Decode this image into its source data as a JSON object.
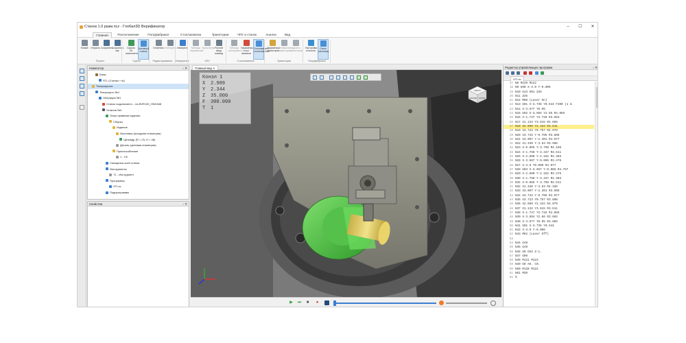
{
  "window": {
    "title": "Станок 1.0 разм.ncz - Глобал3D Верификатор",
    "min": "–",
    "max": "☐",
    "close": "✕"
  },
  "menu_tabs": [
    {
      "label": "Главная",
      "active": true
    },
    {
      "label": "Расположение",
      "active": false
    },
    {
      "label": "Полуфабрикат",
      "active": false
    },
    {
      "label": "Стол/захватки",
      "active": false
    },
    {
      "label": "Траектории",
      "active": false
    },
    {
      "label": "ЧПУ и станок",
      "active": false
    },
    {
      "label": "Анализ",
      "active": false
    },
    {
      "label": "Вид",
      "active": false
    }
  ],
  "ribbon": {
    "buttons": [
      {
        "label": "Новый",
        "color": "#7a8a99",
        "dim": false,
        "sel": false
      },
      {
        "label": "Открыть",
        "color": "#7a8a99",
        "dim": false,
        "sel": false
      },
      {
        "label": "Сохранить",
        "color": "#4c6f95",
        "dim": false,
        "sel": false
      },
      {
        "label": "Сохранить как",
        "color": "#4c6f95",
        "dim": false,
        "sel": false
      },
      {
        "label": "Скрыть СК компонентов",
        "color": "#3f9a5a",
        "dim": false,
        "sel": false
      },
      {
        "label": "Активный станок",
        "color": "#4a8fd6",
        "dim": false,
        "sel": true
      },
      {
        "label": "Отменить",
        "color": "#7b8894",
        "dim": false,
        "sel": false
      },
      {
        "label": "Повторить",
        "color": "#7b8894",
        "dim": true,
        "sel": false
      },
      {
        "label": "Измерить",
        "color": "#3b7fcc",
        "dim": false,
        "sel": false
      },
      {
        "label": "Таблица параметров",
        "color": "#a0a8b0",
        "dim": true,
        "sel": false
      },
      {
        "label": "Транслятор",
        "color": "#a0a8b0",
        "dim": true,
        "sel": false
      },
      {
        "label": "Ручной ввод команд",
        "color": "#6b7d8f",
        "dim": false,
        "sel": false
      },
      {
        "label": "Таблица инструмента",
        "color": "#a0a8b0",
        "dim": true,
        "sel": false
      },
      {
        "label": "Параметры стол/захватки",
        "color": "#d44a3a",
        "dim": false,
        "sel": false
      },
      {
        "label": "Отслеживать столкновения",
        "color": "#4a8fd6",
        "dim": false,
        "sel": true
      },
      {
        "label": "Параметры траектории",
        "color": "#d4a53a",
        "dim": false,
        "sel": false
      },
      {
        "label": "Отобразить траекторию",
        "color": "#a0a8b0",
        "dim": true,
        "sel": false
      },
      {
        "label": "Удалить траекторию",
        "color": "#a0a8b0",
        "dim": true,
        "sel": false
      },
      {
        "label": "Настройки точности",
        "color": "#3a8fd0",
        "dim": false,
        "sel": false
      },
      {
        "label": "Снять заготовку",
        "color": "#4a8fd6",
        "dim": false,
        "sel": true
      }
    ],
    "groups": [
      "Проект",
      "Сцена",
      "Редактирование",
      "Измерение",
      "ЧПУ",
      "Столкновения",
      "Траектории",
      "Полуфабрикат"
    ]
  },
  "navigator": {
    "title": "Навигатор",
    "items": [
      {
        "label": "Базы",
        "indent": 1,
        "color": "#8a6a3a",
        "hl": false
      },
      {
        "label": "STL (Станки.+ st)",
        "indent": 2,
        "color": "#3a7ed0",
        "hl": false
      },
      {
        "label": "Техпроцессы",
        "indent": 0,
        "color": "#e0b33a",
        "hl": true
      },
      {
        "label": "Техпроцесс №1",
        "indent": 1,
        "color": "#3a7ed0",
        "hl": false
      },
      {
        "label": "Операция №1",
        "indent": 2,
        "color": "#3a7ed0",
        "hl": false
      },
      {
        "label": "Станок подключен/о... на BVR130_HNC848",
        "indent": 3,
        "color": "#d04a3a",
        "hl": false
      },
      {
        "label": "Установ №1",
        "indent": 3,
        "color": "#555555",
        "hl": false
      },
      {
        "label": "Точки привязки изделия",
        "indent": 4,
        "color": "#3a9a5a",
        "hl": false
      },
      {
        "label": "Сборка",
        "indent": 5,
        "color": "#e0b33a",
        "hl": false
      },
      {
        "label": "Изделие",
        "indent": 6,
        "color": "#e0b33a",
        "hl": false
      },
      {
        "label": "Заготовка (исходная геометрия)",
        "indent": 7,
        "color": "#e0b33a",
        "hl": false
      },
      {
        "label": "Цилиндр (R = 23, H = 46)",
        "indent": 8,
        "color": "#3a9a5a",
        "hl": false
      },
      {
        "label": "Деталь (целевая геометрия)",
        "indent": 7,
        "color": "#9a9a9a",
        "hl": false
      },
      {
        "label": "Приспособление",
        "indent": 6,
        "color": "#e0b33a",
        "hl": false
      },
      {
        "label": "1 - СК",
        "indent": 7,
        "color": "#9a9a9a",
        "hl": false
      },
      {
        "label": "Смещения осей станка",
        "indent": 4,
        "color": "#3a7ed0",
        "hl": false
      },
      {
        "label": "Инструменты",
        "indent": 4,
        "color": "#3a7ed0",
        "hl": false
      },
      {
        "label": "T1 - Инструмент",
        "indent": 5,
        "color": "#9a9a9a",
        "hl": false
      },
      {
        "label": "Программы",
        "indent": 4,
        "color": "#3a7ed0",
        "hl": false
      },
      {
        "label": "VTI.nc",
        "indent": 5,
        "color": "#3a7ed0",
        "hl": false
      },
      {
        "label": "Подпрограммы",
        "indent": 4,
        "color": "#3a7ed0",
        "hl": false
      }
    ]
  },
  "properties": {
    "title": "Свойства"
  },
  "viewport": {
    "tab": "Главный вид",
    "close": "✕",
    "readout": {
      "title": "Конэл 1",
      "rows": [
        {
          "axis": "X",
          "value": "2.989"
        },
        {
          "axis": "Y",
          "value": "2.344"
        },
        {
          "axis": "Z",
          "value": "35.000"
        },
        {
          "axis": "F",
          "value": "300.000"
        },
        {
          "axis": "T",
          "value": "1"
        }
      ]
    },
    "cube_labels": {
      "top": "СВЕРХУ",
      "left": "СПЕРЕДИ",
      "right": "СПРАВА"
    }
  },
  "editor": {
    "title": "Редактор управляющих программ",
    "file_tab": "VTI.nc",
    "highlight_line": 27,
    "lines": [
      {
        "n": "17",
        "t": "N8 M120 M122"
      },
      {
        "n": "18",
        "t": "N9 G00 X-3.0 Y-0.006"
      },
      {
        "n": "19",
        "t": "N10 G43 H01 Z35"
      },
      {
        "n": "20",
        "t": "N11 Z35"
      },
      {
        "n": "21",
        "t": "N12 M60 (Laser On)"
      },
      {
        "n": "22",
        "t": "N13 G01 X-3.735 Y0.544 F300 (1 m"
      },
      {
        "n": "23",
        "t": "N14 X-3.677 Y0.95"
      },
      {
        "n": "24",
        "t": "N15 G02 X-3.694 Y2.66 R4.065"
      },
      {
        "n": "25",
        "t": "N16 X-1.747 Y3.728 R3.683"
      },
      {
        "n": "26",
        "t": "N17 X1.134 Y3.615 R4.065"
      },
      {
        "n": "27",
        "t": "N18 X2.989 Y2.344 R3.611"
      },
      {
        "n": "28",
        "t": "N19 X3.723 Y0.757 R4.079"
      },
      {
        "n": "29",
        "t": "N20 X3.733 Y-0.706 R3.808"
      },
      {
        "n": "30",
        "t": "N21 X3.007 Y-2.301 R4.077"
      },
      {
        "n": "31",
        "t": "N22 X1.340 Y-3.53 R3.506"
      },
      {
        "n": "32",
        "t": "N23 X-0.065 Y-3.798 R4.188"
      },
      {
        "n": "33",
        "t": "N24 X-1.750 Y-3.347 R3.511"
      },
      {
        "n": "34",
        "t": "N25 X-2.890 Y-2.162 R4.303"
      },
      {
        "n": "35",
        "t": "N26 X-3.667 Y-0.085 R3.476"
      },
      {
        "n": "36",
        "t": "N27 X-3.8 Y0.000 R4.077"
      },
      {
        "n": "37",
        "t": "N28 G03 X-3.667 Y-0.085 R4.757"
      },
      {
        "n": "38",
        "t": "N29 X-2.890 Y-2.162 R3.476"
      },
      {
        "n": "39",
        "t": "N30 X-1.750 Y-3.347 R4.303"
      },
      {
        "n": "40",
        "t": "N31 X-0.065 Y-3.798 R3.511"
      },
      {
        "n": "41",
        "t": "N32 X1.340 Y-3.53 R4.188"
      },
      {
        "n": "42",
        "t": "N33 X3.007 Y-2.301 R3.506"
      },
      {
        "n": "43",
        "t": "N34 X3.733 Y-0.706 R4.077"
      },
      {
        "n": "44",
        "t": "N35 X3.723 Y0.757 R3.808"
      },
      {
        "n": "45",
        "t": "N36 X2.989 Y2.344 R4.079"
      },
      {
        "n": "46",
        "t": "N37 X1.134 Y3.615 R3.611"
      },
      {
        "n": "47",
        "t": "N38 X-1.747 Y3.728 R4.065"
      },
      {
        "n": "48",
        "t": "N39 X-3.694 Y2.66 R3.683"
      },
      {
        "n": "49",
        "t": "N40 X-3.677 Y0.95 R4.065"
      },
      {
        "n": "50",
        "t": "N41 G01 X-3.735 Y0.544"
      },
      {
        "n": "51",
        "t": "N42 X-3.0 Y-0.006"
      },
      {
        "n": "52",
        "t": "N43 M62 (Laser Off)"
      },
      {
        "n": "53",
        "t": ""
      },
      {
        "n": "54",
        "t": "N44 G49"
      },
      {
        "n": "55",
        "t": "N45 G49"
      },
      {
        "n": "56",
        "t": "N46 G0 G53 Z-1."
      },
      {
        "n": "57",
        "t": "N47 G90"
      },
      {
        "n": "58",
        "t": "N48 M121 M123"
      },
      {
        "n": "59",
        "t": "N49 G0 A0. C0."
      },
      {
        "n": "60",
        "t": "N50 M120 M122"
      },
      {
        "n": "61",
        "t": "N51 M30"
      },
      {
        "n": "62",
        "t": "%"
      }
    ]
  },
  "playbar": {
    "play": "▶",
    "step": "⏭",
    "stop": "■",
    "rec": "●"
  }
}
